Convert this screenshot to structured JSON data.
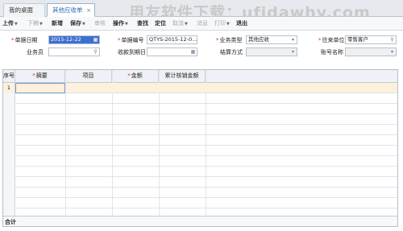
{
  "tabs": [
    {
      "label": "我的桌面"
    },
    {
      "label": "其他应收单",
      "close": "×"
    }
  ],
  "watermark": "用友软件下载：ufidawhy.com",
  "toolbar": {
    "upload": "上传",
    "download": "下稿",
    "add": "新增",
    "save": "保存",
    "audit": "审核",
    "operate": "操作",
    "find": "查找",
    "locate": "定位",
    "unaudit": "取消",
    "message": "消息",
    "print": "打印",
    "exit": "退出"
  },
  "form": {
    "doc_date_label": "单据日期",
    "doc_date_value": "2015-12-22",
    "doc_no_label": "单据编号",
    "doc_no_value": "QTYS-2015-12-0...",
    "biz_type_label": "业务类型",
    "biz_type_value": "其他应收",
    "partner_label": "往来单位",
    "partner_value": "零售客户",
    "salesman_label": "业务员",
    "salesman_value": "",
    "due_date_label": "收款到期日",
    "due_date_value": "",
    "settle_label": "结算方式",
    "settle_value": "",
    "account_label": "账号名称",
    "account_value": ""
  },
  "grid": {
    "columns": [
      "序号",
      "摘要",
      "项目",
      "金额",
      "累计核销金额"
    ],
    "required": [
      false,
      true,
      false,
      true,
      false
    ],
    "first_row_no": "1",
    "footer_label": "合计"
  }
}
